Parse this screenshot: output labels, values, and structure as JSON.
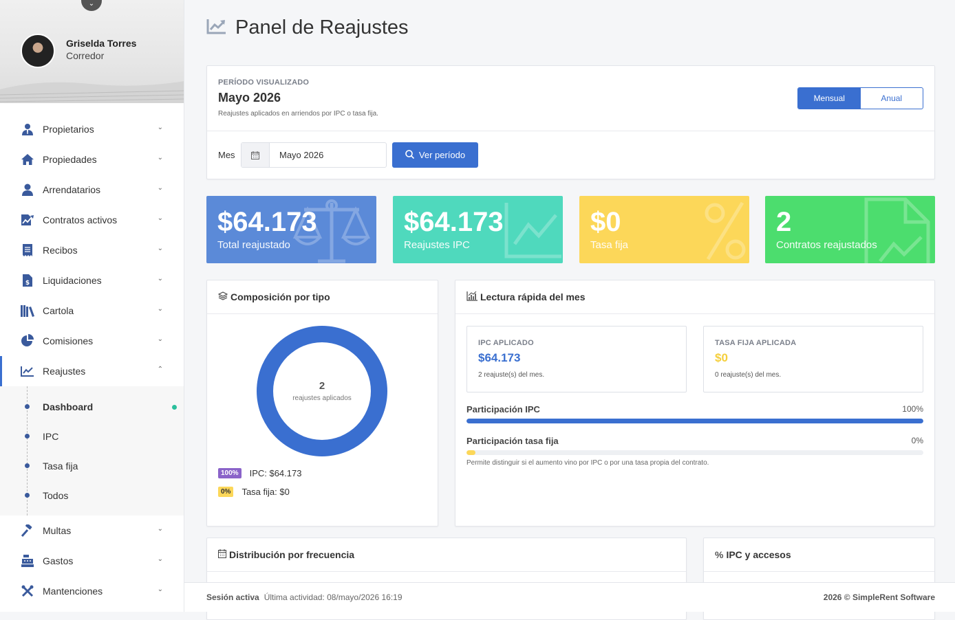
{
  "sidebar": {
    "user": {
      "name": "Griselda Torres",
      "role": "Corredor"
    },
    "items": [
      {
        "label": "Propietarios",
        "icon": "user-tie-icon"
      },
      {
        "label": "Propiedades",
        "icon": "home-icon"
      },
      {
        "label": "Arrendatarios",
        "icon": "user-icon"
      },
      {
        "label": "Contratos activos",
        "icon": "contract-icon"
      },
      {
        "label": "Recibos",
        "icon": "receipt-icon"
      },
      {
        "label": "Liquidaciones",
        "icon": "invoice-dollar-icon"
      },
      {
        "label": "Cartola",
        "icon": "books-icon"
      },
      {
        "label": "Comisiones",
        "icon": "pie-chart-icon"
      },
      {
        "label": "Reajustes",
        "icon": "chart-line-icon"
      },
      {
        "label": "Multas",
        "icon": "gavel-icon"
      },
      {
        "label": "Gastos",
        "icon": "cash-register-icon"
      },
      {
        "label": "Mantenciones",
        "icon": "tools-icon"
      }
    ],
    "sub_items": [
      {
        "label": "Dashboard"
      },
      {
        "label": "IPC"
      },
      {
        "label": "Tasa fija"
      },
      {
        "label": "Todos"
      }
    ]
  },
  "page": {
    "title": "Panel de Reajustes"
  },
  "periodo": {
    "label": "PERÍODO VISUALIZADO",
    "value": "Mayo 2026",
    "description": "Reajustes aplicados en arriendos por IPC o tasa fija.",
    "toggle": {
      "mensual": "Mensual",
      "anual": "Anual"
    },
    "mes_label": "Mes",
    "mes_value": "Mayo 2026",
    "button": "Ver período"
  },
  "stats": [
    {
      "value": "$64.173",
      "label": "Total reajustado",
      "color": "#5b8ad8"
    },
    {
      "value": "$64.173",
      "label": "Reajustes IPC",
      "color": "#4fd9bd"
    },
    {
      "value": "$0",
      "label": "Tasa fija",
      "color": "#fcd759"
    },
    {
      "value": "2",
      "label": "Contratos reajustados",
      "color": "#4cdd6e"
    }
  ],
  "composicion": {
    "title": "Composición por tipo",
    "center_value": "2",
    "center_label": "reajustes aplicados",
    "legend": [
      {
        "badge": "100%",
        "text": "IPC: $64.173",
        "color": "#8a63c9"
      },
      {
        "badge": "0%",
        "text": "Tasa fija: $0",
        "color": "#fcd759"
      }
    ]
  },
  "lectura": {
    "title": "Lectura rápida del mes",
    "ipc": {
      "label": "IPC APLICADO",
      "value": "$64.173",
      "detail": "2 reajuste(s) del mes.",
      "color": "#3a6fd0"
    },
    "fija": {
      "label": "TASA FIJA APLICADA",
      "value": "$0",
      "detail": "0 reajuste(s) del mes.",
      "color": "#f5cf3c"
    },
    "part_ipc": {
      "label": "Participación IPC",
      "percent": "100%",
      "fraction": 1.0
    },
    "part_fija": {
      "label": "Participación tasa fija",
      "percent": "0%",
      "fraction": 0.0
    },
    "note": "Permite distinguir si el aumento vino por IPC o por una tasa propia del contrato."
  },
  "distribucion": {
    "title": "Distribución por frecuencia"
  },
  "ipc_accesos": {
    "title": "IPC y accesos"
  },
  "footer": {
    "session": "Sesión activa",
    "last_activity": "Última actividad: 08/mayo/2026 16:19",
    "copyright": "2026 © SimpleRent Software"
  }
}
